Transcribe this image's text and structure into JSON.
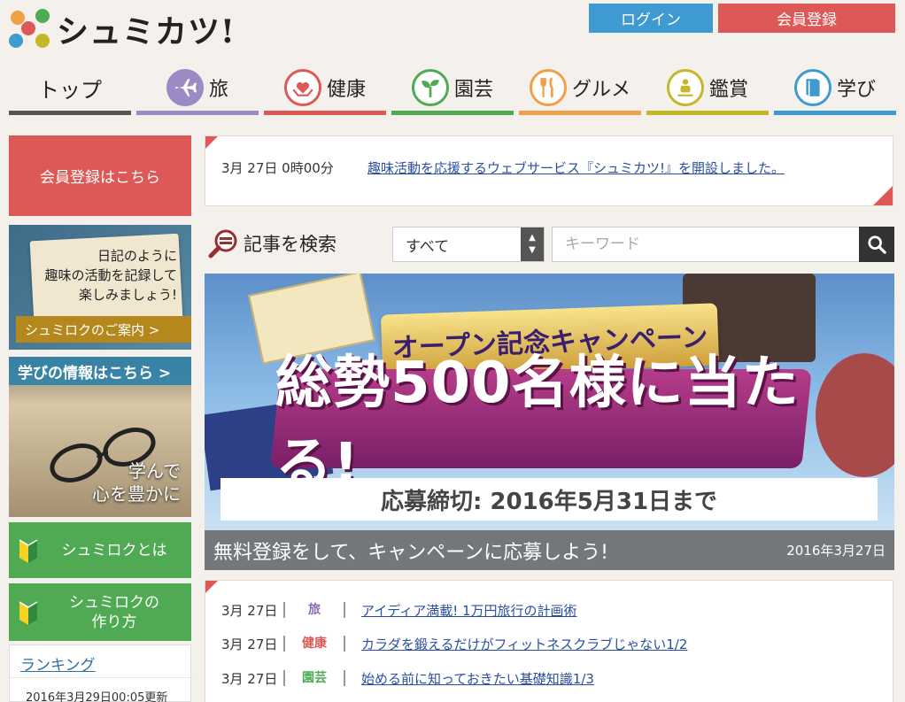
{
  "header": {
    "logo_text": "シュミカツ!",
    "login_label": "ログイン",
    "register_label": "会員登録"
  },
  "nav": [
    {
      "label": "トップ",
      "icon": "none",
      "color": "#555555"
    },
    {
      "label": "旅",
      "icon": "airplane-icon",
      "color": "#9b8ac4"
    },
    {
      "label": "健康",
      "icon": "heart-hands-icon",
      "color": "#dc5957"
    },
    {
      "label": "園芸",
      "icon": "sprout-icon",
      "color": "#4faa53"
    },
    {
      "label": "グルメ",
      "icon": "fork-knife-icon",
      "color": "#f0a04b"
    },
    {
      "label": "鑑賞",
      "icon": "audience-icon",
      "color": "#c6b72a"
    },
    {
      "label": "学び",
      "icon": "book-icon",
      "color": "#3f9ad1"
    }
  ],
  "sidebar": {
    "register_label": "会員登録はこちら",
    "diary_text": "日記のように\n趣味の活動を記録して\n楽しみましょう!",
    "diary_button": "シュミロクのご案内 >",
    "learn_head": "学びの情報はこちら >",
    "learn_text": "学んで\n心を豊かに",
    "about_label": "シュミロクとは",
    "howto_label": "シュミロクの\n作り方",
    "ranking_title": "ランキング",
    "ranking_updated": "2016年3月29日00:05更新"
  },
  "news": {
    "date": "3月 27日 0時00分",
    "link": "趣味活動を応援するウェブサービス『シュミカツ!』を開設しました。"
  },
  "search": {
    "label": "記事を検索",
    "select_value": "すべて",
    "keyword_placeholder": "キーワード"
  },
  "banner": {
    "ribbon": "オープン記念キャンペーン",
    "main": "総勢500名様に当たる!",
    "deadline": "応募締切: 2016年5月31日まで",
    "caption": "無料登録をして、キャンペーンに応募しよう!",
    "caption_date": "2016年3月27日"
  },
  "articles": [
    {
      "date": "3月 27日",
      "category": "旅",
      "cat_color": "#8a6bb5",
      "title": "アイディア満載! 1万円旅行の計画術"
    },
    {
      "date": "3月 27日",
      "category": "健康",
      "cat_color": "#dc5957",
      "title": "カラダを鍛えるだけがフィットネスクラブじゃない1/2"
    },
    {
      "date": "3月 27日",
      "category": "園芸",
      "cat_color": "#4faa53",
      "title": "始める前に知っておきたい基礎知識1/3"
    }
  ]
}
